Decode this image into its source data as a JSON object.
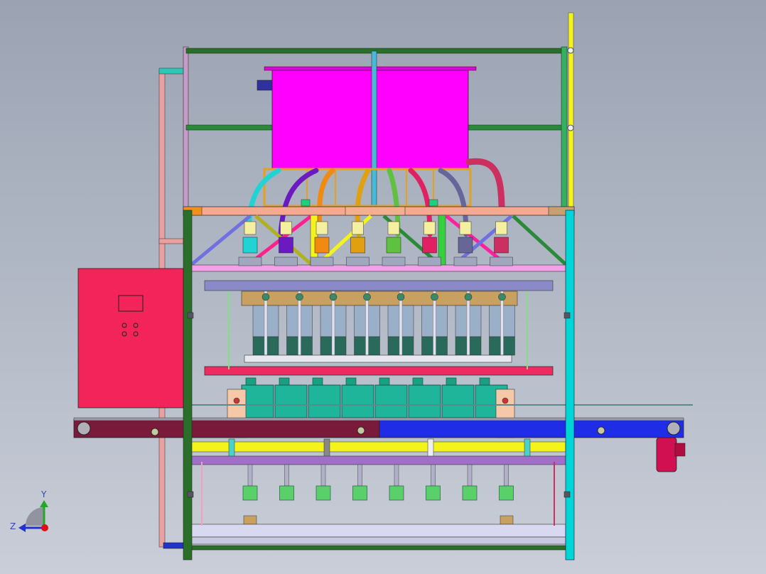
{
  "view": {
    "background_top": "#9ba3b3",
    "background_bottom": "#c9ced8"
  },
  "triad": {
    "axis_y_label": "Y",
    "axis_z_label": "Z",
    "colors": {
      "y": "#22aa22",
      "z": "#2233cc",
      "origin": "#dd1111"
    }
  },
  "machine": {
    "filling_heads_count": 8,
    "containers_count": 8,
    "nozzles_count": 8,
    "colors": {
      "tank": "#ff00ff",
      "frame_green": "#2a6e2a",
      "frame_cyan": "#00d5d5",
      "control_cabinet": "#f2245a",
      "conveyor_left": "#7a1a3a",
      "conveyor_right": "#1f2ee6",
      "container": "#1fb59a",
      "yellow_beam": "#f4f41a",
      "motor": "#d01050"
    },
    "hose_colors": [
      "#22d3d3",
      "#6a1ac0",
      "#f08a10",
      "#e0a010",
      "#60c040",
      "#e02060",
      "#666699",
      "#cc3060"
    ]
  }
}
